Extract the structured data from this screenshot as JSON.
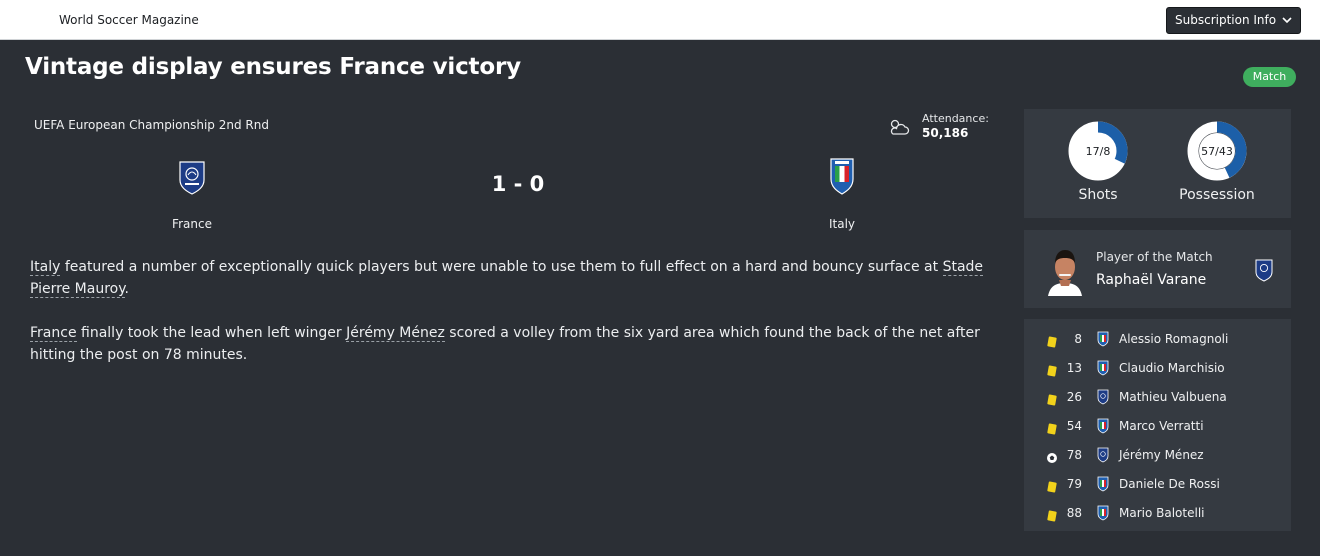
{
  "topbar": {
    "publication": "World Soccer Magazine",
    "subscription_label": "Subscription Info"
  },
  "article": {
    "headline": "Vintage display ensures France victory",
    "badge": "Match",
    "competition": "UEFA European Championship 2nd Rnd",
    "attendance_label": "Attendance:",
    "attendance_value": "50,186",
    "home_team": "France",
    "away_team": "Italy",
    "score": "1 - 0",
    "p1": {
      "link1": "Italy",
      "t1": " featured a number of exceptionally quick players but were unable to use them to full effect on a hard and bouncy surface at ",
      "link2": "Stade Pierre Mauroy",
      "t2": "."
    },
    "p2": {
      "link1": "France",
      "t1": " finally took the lead when left winger ",
      "link2": "Jérémy Ménez",
      "t2": " scored a volley from the six yard area which found the back of the net after hitting the post on 78 minutes."
    }
  },
  "stats": {
    "shots": {
      "label": "Shots",
      "text": "17/8",
      "home_share": 0.68
    },
    "possession": {
      "label": "Possession",
      "text": "57/43",
      "home_share": 0.57
    }
  },
  "potm": {
    "title": "Player of the Match",
    "name": "Raphaël Varane"
  },
  "events": [
    {
      "icon": "yellow-card",
      "minute": "8",
      "team": "Italy",
      "player": "Alessio Romagnoli"
    },
    {
      "icon": "yellow-card",
      "minute": "13",
      "team": "Italy",
      "player": "Claudio Marchisio"
    },
    {
      "icon": "yellow-card",
      "minute": "26",
      "team": "France",
      "player": "Mathieu Valbuena"
    },
    {
      "icon": "yellow-card",
      "minute": "54",
      "team": "Italy",
      "player": "Marco Verratti"
    },
    {
      "icon": "goal-ball",
      "minute": "78",
      "team": "France",
      "player": "Jérémy Ménez"
    },
    {
      "icon": "yellow-card",
      "minute": "79",
      "team": "Italy",
      "player": "Daniele De Rossi"
    },
    {
      "icon": "yellow-card",
      "minute": "88",
      "team": "Italy",
      "player": "Mario Balotelli"
    }
  ],
  "colors": {
    "accent_blue": "#1c5fa8",
    "badge_green": "#3fae5e",
    "card_yellow": "#f2d21b"
  }
}
